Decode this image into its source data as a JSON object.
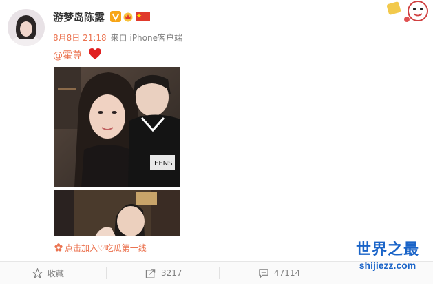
{
  "post": {
    "author": "游梦岛陈露",
    "time": "8月8日 21:18",
    "source": "来自 iPhone客户端",
    "mention": "@霍尊",
    "footer_source": "点击加入♡吃瓜第一线"
  },
  "actions": {
    "favorite_label": "收藏",
    "repost_count": "3217",
    "comment_count": "47114"
  },
  "watermark": {
    "line1": "世界之最",
    "line2": "shijiezz.com"
  },
  "colors": {
    "accent": "#eb7350",
    "watermark": "#1a64c8",
    "verified": "#f7a516",
    "flag": "#e03a2c"
  }
}
